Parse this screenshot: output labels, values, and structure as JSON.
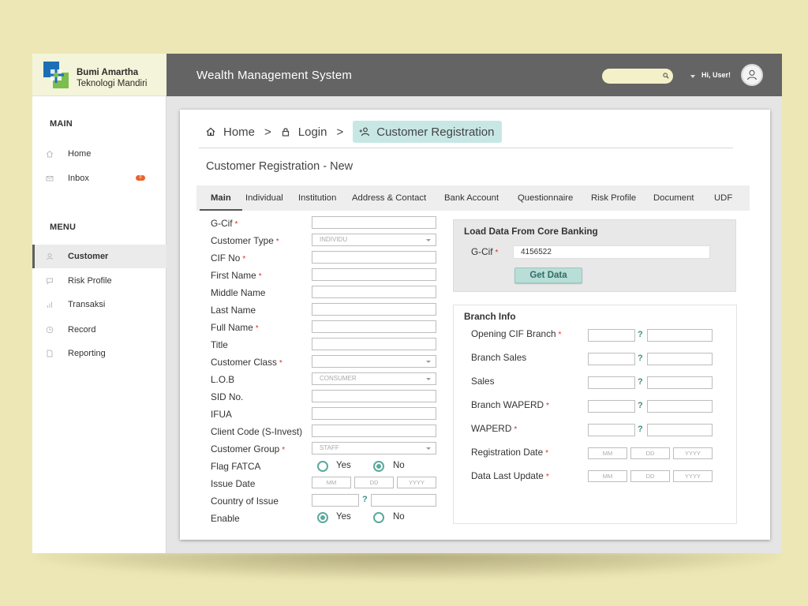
{
  "brand": {
    "line1": "Bumi Amartha",
    "line2": "Teknologi Mandiri"
  },
  "sidebar": {
    "main_section": "MAIN",
    "menu_section": "MENU",
    "main_items": [
      {
        "label": "Home",
        "icon": "home-icon"
      },
      {
        "label": "Inbox",
        "icon": "mail-icon",
        "badge": "0"
      }
    ],
    "menu_items": [
      {
        "label": "Customer",
        "icon": "user-icon",
        "active": true
      },
      {
        "label": "Risk Profile",
        "icon": "chat-icon"
      },
      {
        "label": "Transaksi",
        "icon": "bars-icon"
      },
      {
        "label": "Record",
        "icon": "clock-icon"
      },
      {
        "label": "Reporting",
        "icon": "document-icon"
      }
    ]
  },
  "header": {
    "title": "Wealth Management System",
    "greeting": "Hi, User!",
    "search_placeholder": ""
  },
  "breadcrumb": {
    "home": "Home",
    "sep": ">",
    "login": "Login",
    "current": "Customer Registration"
  },
  "page_title": "Customer Registration - New",
  "tabs": [
    "Main",
    "Individual",
    "Institution",
    "Address & Contact",
    "Bank Account",
    "Questionnaire",
    "Risk Profile",
    "Document",
    "UDF"
  ],
  "form": {
    "required_mark": "*",
    "labels": {
      "gcif": "G-Cif",
      "customer_type": "Customer Type",
      "cif_no": "CIF No",
      "first_name": "First Name",
      "middle_name": "Middle Name",
      "last_name": "Last Name",
      "full_name": "Full Name",
      "title": "Title",
      "customer_class": "Customer Class",
      "lob": "L.O.B",
      "sid_no": "SID No.",
      "ifua": "IFUA",
      "client_code": "Client Code (S-Invest)",
      "customer_group": "Customer Group",
      "flag_fatca": "Flag FATCA",
      "issue_date": "Issue Date",
      "country_of_issue": "Country of Issue",
      "enable": "Enable"
    },
    "customer_type_value": "INDIVIDU",
    "lob_value": "CONSUMER",
    "customer_group_value": "STAFF",
    "date_placeholders": {
      "mm": "MM",
      "dd": "DD",
      "yyyy": "YYYY"
    },
    "yes": "Yes",
    "no": "No",
    "help": "?",
    "fatca_selected": "No",
    "enable_selected": "Yes"
  },
  "load_panel": {
    "title": "Load Data From Core Banking",
    "gcif_label": "G-Cif",
    "gcif_value": "4156522",
    "button": "Get Data"
  },
  "branch_panel": {
    "title": "Branch Info",
    "labels": {
      "opening_cif_branch": "Opening CIF Branch",
      "branch_sales": "Branch Sales",
      "sales": "Sales",
      "branch_waperd": "Branch WAPERD",
      "waperd": "WAPERD",
      "registration_date": "Registration Date",
      "data_last_update": "Data Last Update"
    }
  },
  "colors": {
    "accent": "#5aa99d",
    "header_bg": "#646464",
    "page_bg": "#ede7b5",
    "required": "#d9302b",
    "badge": "#e8642c"
  }
}
